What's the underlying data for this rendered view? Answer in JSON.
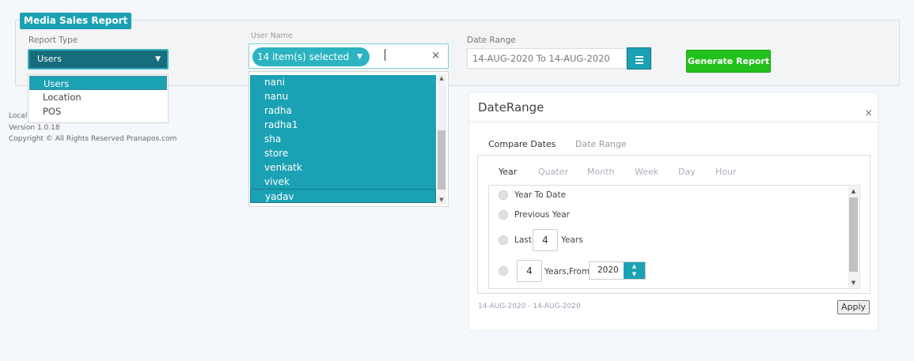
{
  "header": {
    "title": "Media Sales Report"
  },
  "report_type": {
    "label": "Report Type",
    "selected": "Users",
    "options": [
      "Users",
      "Location",
      "POS"
    ]
  },
  "user_name": {
    "label": "User Name",
    "selected_summary": "14 item(s) selected",
    "clear_symbol": "×",
    "options": [
      "nani",
      "nanu",
      "radha",
      "radha1",
      "sha",
      "store",
      "venkatk",
      "vivek",
      "yadav"
    ]
  },
  "date_range": {
    "label": "Date Range",
    "value": "14-AUG-2020 To 14-AUG-2020"
  },
  "generate_button": {
    "label": "Generate Report"
  },
  "footer": {
    "local": "Local",
    "version": "Version 1.0.18",
    "copyright": "Copyright © All Rights Reserved Pranapos.com"
  },
  "date_range_panel": {
    "title": "DateRange",
    "close_symbol": "×",
    "tabs": [
      "Compare Dates",
      "Date Range"
    ],
    "periods": [
      "Year",
      "Quater",
      "Month",
      "Week",
      "Day",
      "Hour"
    ],
    "options": {
      "year_to_date": "Year To Date",
      "previous_year": "Previous Year",
      "last_label": "Last",
      "last_value": "4",
      "years_label": "Years",
      "years_from_value": "4",
      "years_from_label": "Years,From",
      "from_year": "2020"
    },
    "range_text": "14-AUG-2020 - 14-AUG-2020",
    "apply_label": "Apply"
  },
  "colors": {
    "accent": "#1ba1b4",
    "generate": "#22c11c"
  }
}
